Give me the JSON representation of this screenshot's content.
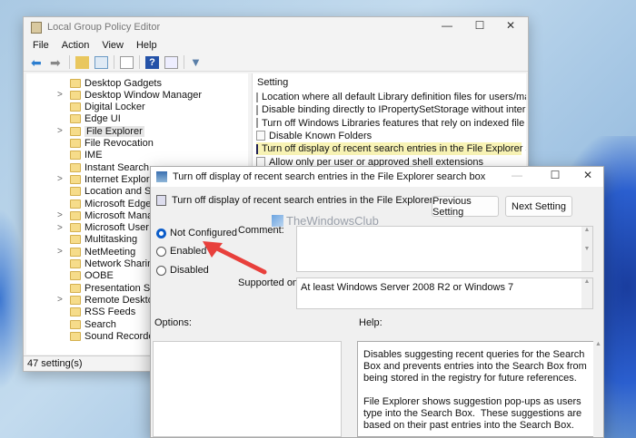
{
  "main_window": {
    "title": "Local Group Policy Editor",
    "menu": [
      "File",
      "Action",
      "View",
      "Help"
    ],
    "tree": [
      {
        "label": "Desktop Gadgets",
        "expandable": false
      },
      {
        "label": "Desktop Window Manager",
        "expandable": true
      },
      {
        "label": "Digital Locker",
        "expandable": false
      },
      {
        "label": "Edge UI",
        "expandable": false
      },
      {
        "label": "File Explorer",
        "expandable": true,
        "selected": true
      },
      {
        "label": "File Revocation",
        "expandable": false
      },
      {
        "label": "IME",
        "expandable": false
      },
      {
        "label": "Instant Search",
        "expandable": false
      },
      {
        "label": "Internet Explorer",
        "expandable": true
      },
      {
        "label": "Location and Sensors",
        "expandable": false
      },
      {
        "label": "Microsoft Edge",
        "expandable": false
      },
      {
        "label": "Microsoft Management Console",
        "expandable": true
      },
      {
        "label": "Microsoft User Experience Virtualization",
        "expandable": true
      },
      {
        "label": "Multitasking",
        "expandable": false
      },
      {
        "label": "NetMeeting",
        "expandable": true
      },
      {
        "label": "Network Sharing",
        "expandable": false
      },
      {
        "label": "OOBE",
        "expandable": false
      },
      {
        "label": "Presentation Settings",
        "expandable": false
      },
      {
        "label": "Remote Desktop Services",
        "expandable": true
      },
      {
        "label": "RSS Feeds",
        "expandable": false
      },
      {
        "label": "Search",
        "expandable": false
      },
      {
        "label": "Sound Recorder",
        "expandable": false
      }
    ],
    "settings_header": "Setting",
    "settings": [
      "Location where all default Library definition files for users/machines re.",
      "Disable binding directly to IPropertySetStorage without intermediate la.",
      "Turn off Windows Libraries features that rely on indexed file data",
      "Disable Known Folders",
      "Turn off display of recent search entries in the File Explorer search box",
      "Allow only per user or approved shell extensions"
    ],
    "selected_setting_index": 4,
    "status": "47 setting(s)"
  },
  "dialog": {
    "title": "Turn off display of recent search entries in the File Explorer search box",
    "heading": "Turn off display of recent search entries in the File Explorer search box",
    "previous_button": "Previous Setting",
    "next_button": "Next Setting",
    "options": [
      "Not Configured",
      "Enabled",
      "Disabled"
    ],
    "selected_option": "Not Configured",
    "comment_label": "Comment:",
    "comment_value": "",
    "supported_label": "Supported on:",
    "supported_value": "At least Windows Server 2008 R2 or Windows 7",
    "options_label": "Options:",
    "help_label": "Help:",
    "help_text": "Disables suggesting recent queries for the Search Box and prevents entries into the Search Box from being stored in the registry for future references.\n\nFile Explorer shows suggestion pop-ups as users type into the Search Box.  These suggestions are based on their past entries into the Search Box.\n\nNote: If you enable this policy, File Explorer will not show"
  },
  "watermark": "TheWindowsClub",
  "colors": {
    "accent": "#0b5cc9",
    "selection": "#f8f3b5",
    "arrow": "#e8403c"
  }
}
